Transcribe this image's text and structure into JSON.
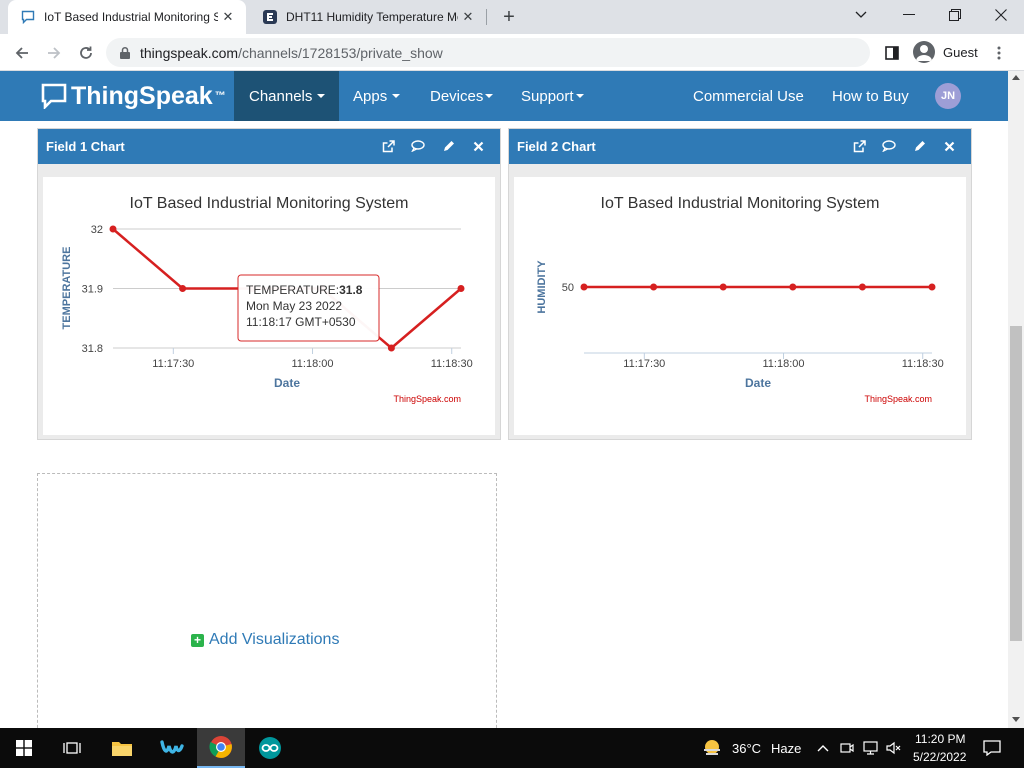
{
  "browser": {
    "tabs": [
      {
        "title": "IoT Based Industrial Monitoring S",
        "active": true
      },
      {
        "title": "DHT11 Humidity Temperature Mo",
        "active": false
      }
    ],
    "url_host": "thingspeak.com",
    "url_path": "/channels/1728153/private_show",
    "profile_label": "Guest"
  },
  "nav": {
    "brand": "ThingSpeak",
    "brand_tm": "™",
    "menu": [
      "Channels",
      "Apps",
      "Devices",
      "Support"
    ],
    "right_links": [
      "Commercial Use",
      "How to Buy"
    ],
    "avatar_initials": "JN"
  },
  "panels": [
    {
      "title": "Field 1 Chart"
    },
    {
      "title": "Field 2 Chart"
    }
  ],
  "chart_data": [
    {
      "type": "line",
      "title": "IoT Based Industrial Monitoring System",
      "xlabel": "Date",
      "ylabel": "TEMPERATURE",
      "x": [
        "11:17:17",
        "11:17:32",
        "11:17:47",
        "11:18:02",
        "11:18:17",
        "11:18:32"
      ],
      "x_ticks": [
        "11:17:30",
        "11:18:00",
        "11:18:30"
      ],
      "y_ticks": [
        "32",
        "31.9",
        "31.8"
      ],
      "ylim": [
        31.8,
        32.0
      ],
      "series": [
        {
          "values": [
            32.0,
            31.9,
            31.9,
            31.9,
            31.8,
            31.9
          ]
        }
      ],
      "color": "#d62020",
      "credit": "ThingSpeak.com",
      "tooltip": {
        "label": "TEMPERATURE:",
        "value": "31.8",
        "date": "Mon May 23 2022",
        "time": "11:18:17 GMT+0530"
      }
    },
    {
      "type": "line",
      "title": "IoT Based Industrial Monitoring System",
      "xlabel": "Date",
      "ylabel": "HUMIDITY",
      "x": [
        "11:17:17",
        "11:17:32",
        "11:17:47",
        "11:18:02",
        "11:18:17",
        "11:18:32"
      ],
      "x_ticks": [
        "11:17:30",
        "11:18:00",
        "11:18:30"
      ],
      "y_ticks": [
        "50"
      ],
      "series": [
        {
          "values": [
            50,
            50,
            50,
            50,
            50,
            50
          ]
        }
      ],
      "color": "#d62020",
      "credit": "ThingSpeak.com"
    }
  ],
  "add_visualizations": "Add Visualizations",
  "taskbar": {
    "weather_temp": "36°C",
    "weather_desc": "Haze",
    "time": "11:20 PM",
    "date": "5/22/2022"
  }
}
